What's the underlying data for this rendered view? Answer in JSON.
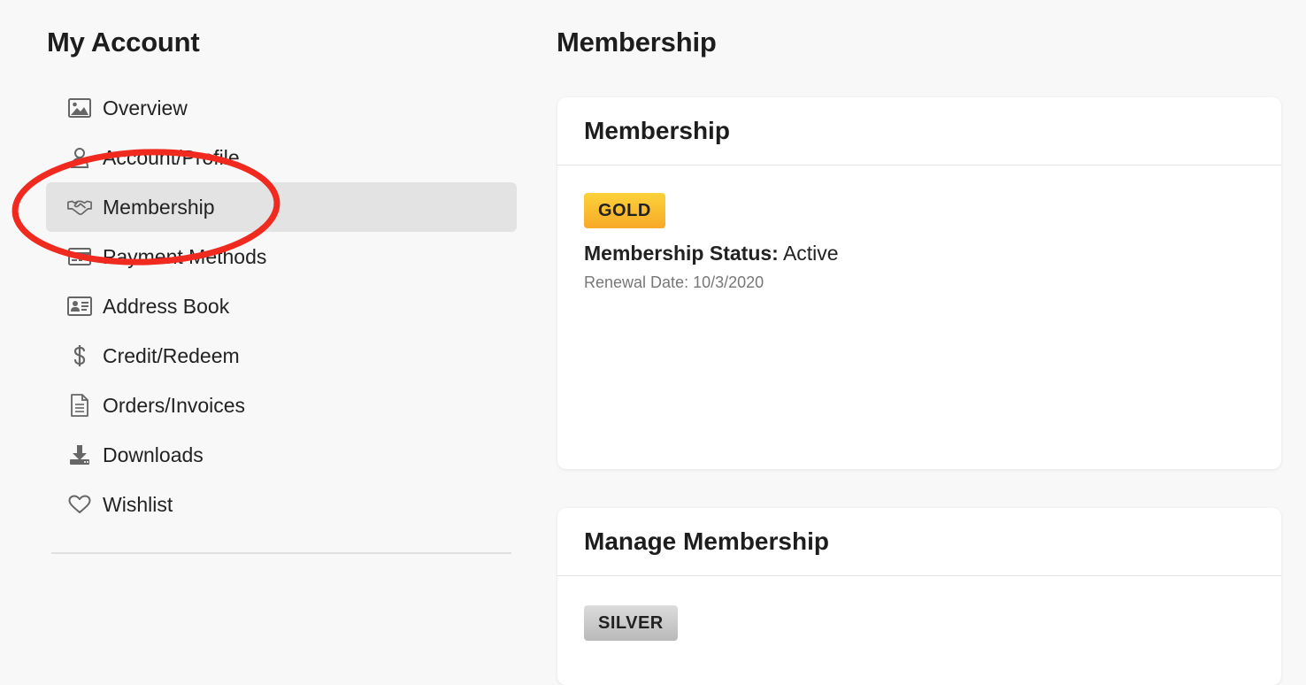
{
  "sidebar": {
    "title": "My Account",
    "items": [
      {
        "label": "Overview",
        "icon": "image-icon"
      },
      {
        "label": "Account/Profile",
        "icon": "user-icon"
      },
      {
        "label": "Membership",
        "icon": "handshake-icon",
        "active": true
      },
      {
        "label": "Payment Methods",
        "icon": "credit-card-icon"
      },
      {
        "label": "Address Book",
        "icon": "id-card-icon"
      },
      {
        "label": "Credit/Redeem",
        "icon": "dollar-icon"
      },
      {
        "label": "Orders/Invoices",
        "icon": "document-icon"
      },
      {
        "label": "Downloads",
        "icon": "download-icon"
      },
      {
        "label": "Wishlist",
        "icon": "heart-icon"
      }
    ]
  },
  "main": {
    "title": "Membership",
    "membership_card": {
      "title": "Membership",
      "badge": "GOLD",
      "status_label": "Membership Status:",
      "status_value": "Active",
      "renewal": "Renewal Date: 10/3/2020"
    },
    "manage_card": {
      "title": "Manage Membership",
      "badge": "SILVER"
    }
  },
  "colors": {
    "gold_badge": "#f9bd2f",
    "silver_badge": "#c8c8c8",
    "annotation_circle": "#f02a1e",
    "active_nav_bg": "#e3e3e3"
  }
}
